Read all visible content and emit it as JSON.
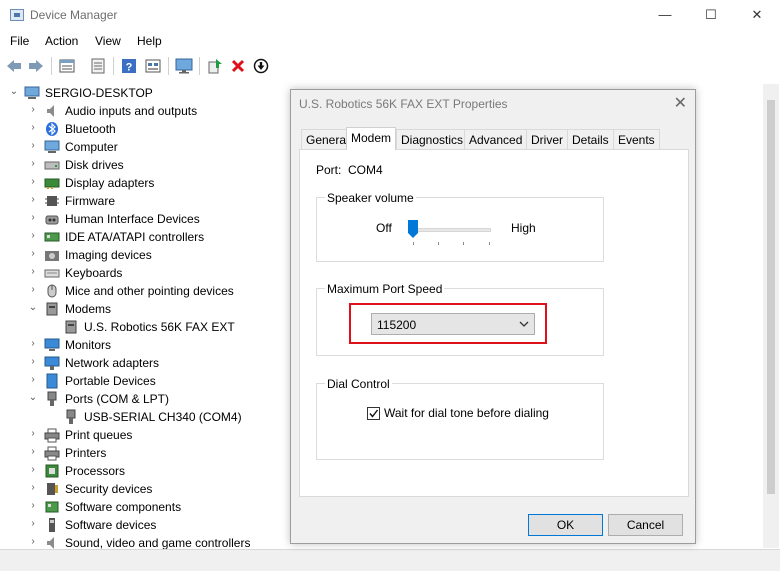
{
  "window": {
    "title": "Device Manager",
    "controls": {
      "minimize": "—",
      "maximize": "☐",
      "close": "✕"
    }
  },
  "menu": [
    "File",
    "Action",
    "View",
    "Help"
  ],
  "toolbar": [
    "back-icon",
    "forward-icon",
    "properties-icon",
    "device-list-icon",
    "help-icon",
    "resources-icon",
    "monitor-icon",
    "update-driver-icon",
    "uninstall-icon",
    "disable-icon"
  ],
  "tree": {
    "root": "SERGIO-DESKTOP",
    "items": [
      {
        "label": "Audio inputs and outputs",
        "icon": "speaker-icon"
      },
      {
        "label": "Bluetooth",
        "icon": "bluetooth-icon"
      },
      {
        "label": "Computer",
        "icon": "computer-icon"
      },
      {
        "label": "Disk drives",
        "icon": "disk-icon"
      },
      {
        "label": "Display adapters",
        "icon": "display-adapter-icon"
      },
      {
        "label": "Firmware",
        "icon": "firmware-icon"
      },
      {
        "label": "Human Interface Devices",
        "icon": "hid-icon"
      },
      {
        "label": "IDE ATA/ATAPI controllers",
        "icon": "ide-icon"
      },
      {
        "label": "Imaging devices",
        "icon": "camera-icon"
      },
      {
        "label": "Keyboards",
        "icon": "keyboard-icon"
      },
      {
        "label": "Mice and other pointing devices",
        "icon": "mouse-icon"
      },
      {
        "label": "Modems",
        "icon": "modem-icon"
      },
      {
        "label": "U.S. Robotics 56K FAX EXT",
        "icon": "modem-icon"
      },
      {
        "label": "Monitors",
        "icon": "monitor-icon"
      },
      {
        "label": "Network adapters",
        "icon": "network-icon"
      },
      {
        "label": "Portable Devices",
        "icon": "portable-icon"
      },
      {
        "label": "Ports (COM & LPT)",
        "icon": "port-icon"
      },
      {
        "label": "USB-SERIAL CH340 (COM4)",
        "icon": "port-icon"
      },
      {
        "label": "Print queues",
        "icon": "printer-icon"
      },
      {
        "label": "Printers",
        "icon": "printer-icon"
      },
      {
        "label": "Processors",
        "icon": "processor-icon"
      },
      {
        "label": "Security devices",
        "icon": "security-icon"
      },
      {
        "label": "Software components",
        "icon": "software-icon"
      },
      {
        "label": "Software devices",
        "icon": "software-icon"
      },
      {
        "label": "Sound, video and game controllers",
        "icon": "sound-icon"
      }
    ]
  },
  "dialog": {
    "title": "U.S. Robotics 56K FAX EXT Properties",
    "tabs": [
      "General",
      "Modem",
      "Diagnostics",
      "Advanced",
      "Driver",
      "Details",
      "Events"
    ],
    "active_tab": "Modem",
    "port_label": "Port:",
    "port_value": "COM4",
    "speaker": {
      "title": "Speaker volume",
      "off_label": "Off",
      "high_label": "High",
      "level": 0
    },
    "port_speed": {
      "title": "Maximum Port Speed",
      "value": "115200"
    },
    "dial": {
      "title": "Dial Control",
      "checkbox_label": "Wait for dial tone before dialing",
      "checked": true
    },
    "ok_label": "OK",
    "cancel_label": "Cancel"
  },
  "colors": {
    "highlight": "#e0101a",
    "accent": "#0078d7"
  }
}
